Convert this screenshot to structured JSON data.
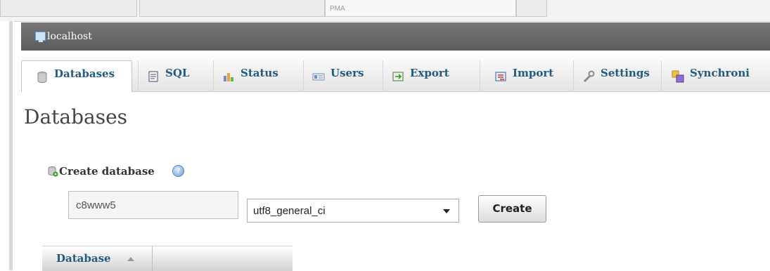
{
  "server": {
    "label": "localhost"
  },
  "tabs": [
    {
      "label": "Databases",
      "icon": "database-icon",
      "active": true
    },
    {
      "label": "SQL",
      "icon": "sql-icon"
    },
    {
      "label": "Status",
      "icon": "status-icon"
    },
    {
      "label": "Users",
      "icon": "users-icon"
    },
    {
      "label": "Export",
      "icon": "export-icon"
    },
    {
      "label": "Import",
      "icon": "import-icon"
    },
    {
      "label": "Settings",
      "icon": "settings-icon"
    },
    {
      "label": "Synchroni",
      "icon": "synchronize-icon"
    }
  ],
  "browser_tabs": [
    "PMA"
  ],
  "page_title": "Databases",
  "create": {
    "label": "Create database",
    "db_name": "c8www5",
    "collation": "utf8_general_ci",
    "button": "Create"
  },
  "table": {
    "header": "Database"
  },
  "colors": {
    "link": "#235a81",
    "server_bar": "#666666"
  }
}
